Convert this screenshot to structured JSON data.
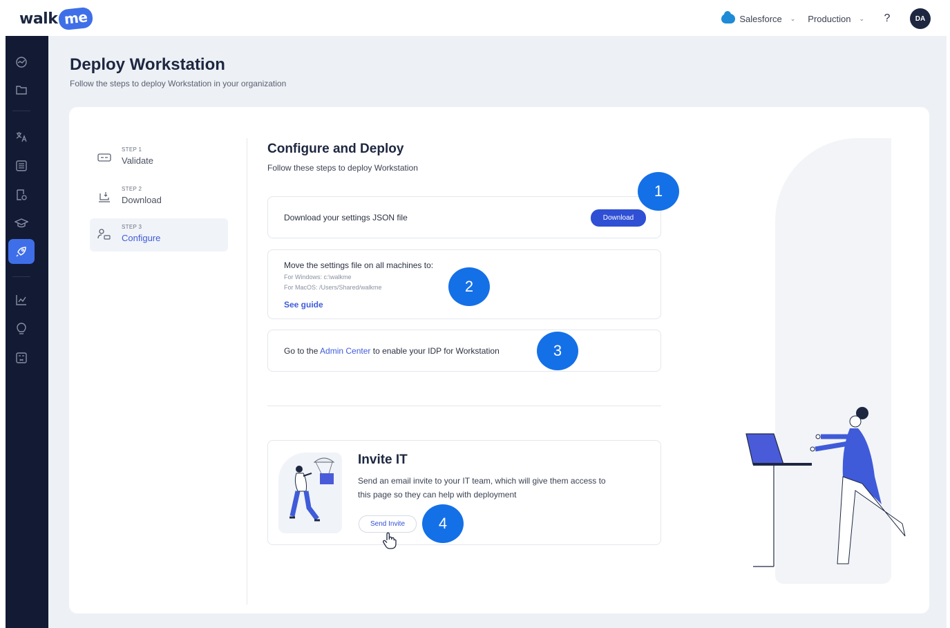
{
  "header": {
    "logo_text": "walk",
    "logo_badge": "me",
    "platform": "Salesforce",
    "environment": "Production",
    "help": "?",
    "avatar_initials": "DA"
  },
  "sidebar": {
    "icons": [
      "dashboard-icon",
      "folder-icon",
      "translate-icon",
      "list-icon",
      "settings-doc-icon",
      "graduation-icon",
      "rocket-icon",
      "chart-icon",
      "lightbulb-icon",
      "calculator-icon"
    ],
    "active": "rocket-icon"
  },
  "page": {
    "title": "Deploy Workstation",
    "subtitle": "Follow the steps to deploy Workstation in your organization"
  },
  "steps": [
    {
      "number": "STEP 1",
      "label": "Validate"
    },
    {
      "number": "STEP 2",
      "label": "Download"
    },
    {
      "number": "STEP 3",
      "label": "Configure",
      "active": true
    }
  ],
  "configure": {
    "title": "Configure and Deploy",
    "subtitle": "Follow these steps to deploy Workstation",
    "download_text": "Download your settings JSON file",
    "download_button": "Download",
    "move_text": "Move the settings file on all machines to:",
    "windows_path": "For Windows: c:\\walkme",
    "mac_path": "For MacOS: /Users/Shared/walkme",
    "see_guide": "See guide",
    "admin_pre": "Go to the ",
    "admin_link": "Admin Center",
    "admin_post": " to enable your IDP for Workstation"
  },
  "invite": {
    "title": "Invite IT",
    "description": "Send an email invite to your IT team, which will give them access to this page so they can help with deployment",
    "button": "Send Invite"
  },
  "badges": [
    "1",
    "2",
    "3",
    "4"
  ],
  "colors": {
    "accent": "#3f6fe8",
    "badge": "#1470e6",
    "sidebar": "#131a33"
  }
}
